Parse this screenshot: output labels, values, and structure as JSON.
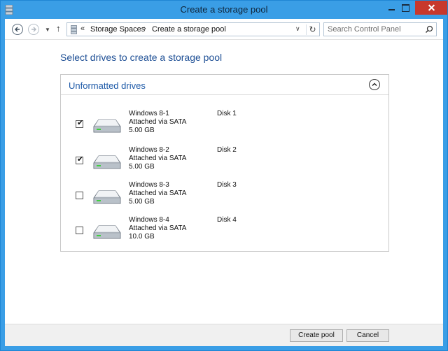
{
  "window": {
    "title": "Create a storage pool",
    "accent": "#3a9ee6",
    "close_color": "#c7382c"
  },
  "address": {
    "overflow": "«",
    "crumbs": [
      "Storage Spaces",
      "Create a storage pool"
    ],
    "separator": "›",
    "search_placeholder": "Search Control Panel"
  },
  "page": {
    "title": "Select drives to create a storage pool"
  },
  "group": {
    "title": "Unformatted drives",
    "drives": [
      {
        "name": "Windows 8-1",
        "bus": "Attached via SATA",
        "size": "5.00 GB",
        "disk": "Disk 1",
        "checked": true
      },
      {
        "name": "Windows 8-2",
        "bus": "Attached via SATA",
        "size": "5.00 GB",
        "disk": "Disk 2",
        "checked": true
      },
      {
        "name": "Windows 8-3",
        "bus": "Attached via SATA",
        "size": "5.00 GB",
        "disk": "Disk 3",
        "checked": false
      },
      {
        "name": "Windows 8-4",
        "bus": "Attached via SATA",
        "size": "10.0 GB",
        "disk": "Disk 4",
        "checked": false
      }
    ]
  },
  "footer": {
    "create_label": "Create pool",
    "cancel_label": "Cancel"
  },
  "icons": {
    "app": "storage-spaces-icon",
    "back": "back-arrow-icon",
    "forward": "forward-arrow-icon",
    "up": "up-arrow-icon",
    "refresh": "refresh-icon",
    "search": "search-icon",
    "collapse": "chevron-up-icon",
    "drive": "hard-drive-icon"
  }
}
